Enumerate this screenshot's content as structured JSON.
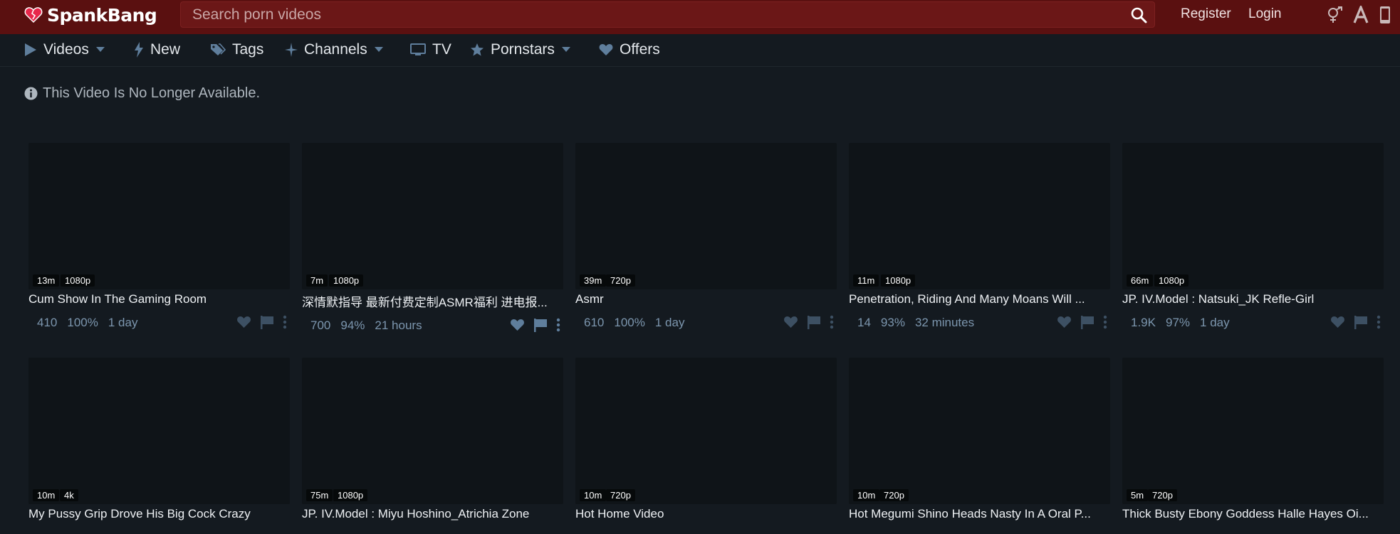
{
  "header": {
    "brand": "SpankBang",
    "search_placeholder": "Search porn videos",
    "register_label": "Register",
    "login_label": "Login",
    "icons": [
      "gender-icon",
      "text-size-icon",
      "phone-icon"
    ]
  },
  "nav": {
    "videos": "Videos",
    "new": "New",
    "tags": "Tags",
    "channels": "Channels",
    "tv": "TV",
    "pornstars": "Pornstars",
    "offers": "Offers"
  },
  "notice": {
    "text": "This Video Is No Longer Available."
  },
  "videos": [
    {
      "duration": "13m",
      "quality": "1080p",
      "title": "Cum Show In The Gaming Room",
      "views": "410",
      "rating": "100%",
      "age": "1 day"
    },
    {
      "duration": "7m",
      "quality": "1080p",
      "title": "深情默指导 最新付费定制ASMR福利 进电报...",
      "views": "700",
      "rating": "94%",
      "age": "21 hours"
    },
    {
      "duration": "39m",
      "quality": "720p",
      "title": "Asmr",
      "views": "610",
      "rating": "100%",
      "age": "1 day"
    },
    {
      "duration": "11m",
      "quality": "1080p",
      "title": "Penetration, Riding And Many Moans Will ...",
      "views": "14",
      "rating": "93%",
      "age": "32 minutes"
    },
    {
      "duration": "66m",
      "quality": "1080p",
      "title": "JP. IV.Model : Natsuki_JK Refle-Girl",
      "views": "1.9K",
      "rating": "97%",
      "age": "1 day"
    },
    {
      "duration": "10m",
      "quality": "4k",
      "title": "My Pussy Grip Drove His Big Cock Crazy"
    },
    {
      "duration": "75m",
      "quality": "1080p",
      "title": "JP. IV.Model : Miyu Hoshino_Atrichia Zone"
    },
    {
      "duration": "10m",
      "quality": "720p",
      "title": "Hot Home Video"
    },
    {
      "duration": "10m",
      "quality": "720p",
      "title": "Hot Megumi Shino Heads Nasty In A Oral P..."
    },
    {
      "duration": "5m",
      "quality": "720p",
      "title": "Thick Busty Ebony Goddess Halle Hayes Oi..."
    }
  ],
  "colors": {
    "header_bg": "#5a1010",
    "page_bg": "#141a20",
    "meta_text": "#7c96ae",
    "icon_blue": "#5f7e9c"
  }
}
